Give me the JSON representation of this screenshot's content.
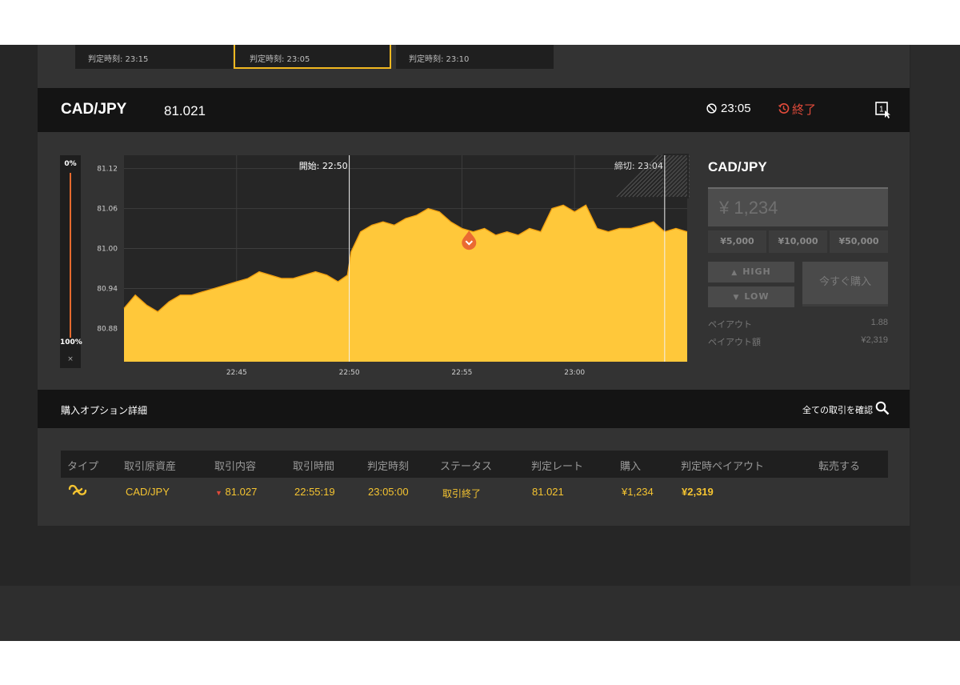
{
  "top_cards": [
    {
      "text": "判定時刻: 23:15"
    },
    {
      "text": "判定時刻: 23:05"
    },
    {
      "text": "判定時刻: 23:10"
    }
  ],
  "header": {
    "pair": "CAD/JPY",
    "price": "81.021",
    "timer": "23:05",
    "status": "終了"
  },
  "slider": {
    "top_label": "0%",
    "bottom_label": "100%",
    "close_label": "×"
  },
  "chart_data": {
    "type": "area",
    "y_ticks": [
      "81.12",
      "81.06",
      "81.00",
      "80.94",
      "80.88"
    ],
    "x_ticks": [
      "22:45",
      "22:50",
      "22:55",
      "23:00"
    ],
    "ylim": [
      80.83,
      81.14
    ],
    "start_label": "開始: 22:50",
    "deadline_label": "締切: 23:04",
    "entry_marker": {
      "time": "22:55:19",
      "value": 81.01
    },
    "series": [
      {
        "x": [
          "22:40:00",
          "22:40:30",
          "22:41:00",
          "22:41:30",
          "22:42:00",
          "22:42:30",
          "22:43:00",
          "22:43:30",
          "22:44:00",
          "22:44:30",
          "22:45:00",
          "22:45:30",
          "22:46:00",
          "22:46:30",
          "22:47:00",
          "22:47:30",
          "22:48:00",
          "22:48:30",
          "22:49:00",
          "22:49:30",
          "22:49:55",
          "22:50:05",
          "22:50:30",
          "22:51:00",
          "22:51:30",
          "22:52:00",
          "22:52:30",
          "22:53:00",
          "22:53:30",
          "22:54:00",
          "22:54:30",
          "22:55:00",
          "22:55:30",
          "22:56:00",
          "22:56:30",
          "22:57:00",
          "22:57:30",
          "22:58:00",
          "22:58:30",
          "22:59:00",
          "22:59:30",
          "23:00:00",
          "23:00:30",
          "23:01:00",
          "23:01:30",
          "23:02:00",
          "23:02:30",
          "23:03:00",
          "23:03:30",
          "23:04:00",
          "23:04:30",
          "23:05:00"
        ],
        "values": [
          80.91,
          80.93,
          80.915,
          80.905,
          80.92,
          80.93,
          80.93,
          80.935,
          80.94,
          80.945,
          80.95,
          80.955,
          80.965,
          80.96,
          80.955,
          80.955,
          80.96,
          80.965,
          80.96,
          80.95,
          80.96,
          80.995,
          81.025,
          81.035,
          81.04,
          81.035,
          81.045,
          81.05,
          81.06,
          81.055,
          81.04,
          81.03,
          81.025,
          81.03,
          81.02,
          81.025,
          81.02,
          81.03,
          81.025,
          81.06,
          81.065,
          81.055,
          81.065,
          81.03,
          81.025,
          81.03,
          81.03,
          81.035,
          81.04,
          81.025,
          81.03,
          81.025
        ]
      }
    ]
  },
  "trade": {
    "pair": "CAD/JPY",
    "amount": "¥ 1,234",
    "presets": [
      "¥5,000",
      "¥10,000",
      "¥50,000"
    ],
    "high_label": "HIGH",
    "low_label": "LOW",
    "buy_now": "今すぐ購入",
    "payout_label": "ペイアウト",
    "payout_value": "1.88",
    "payout_amount_label": "ペイアウト額",
    "payout_amount_value": "¥2,319"
  },
  "details": {
    "title": "購入オプション詳細",
    "view_all": "全ての取引を確認"
  },
  "table": {
    "headers": [
      "タイプ",
      "取引原資産",
      "取引内容",
      "取引時間",
      "判定時刻",
      "ステータス",
      "判定レート",
      "購入",
      "判定時ペイアウト",
      "転売する"
    ],
    "rows": [
      {
        "asset": "CAD/JPY",
        "content": "81.027",
        "time": "22:55:19",
        "judge_time": "23:05:00",
        "status": "取引終了",
        "rate": "81.021",
        "purchase": "¥1,234",
        "payout": "¥2,319"
      }
    ]
  },
  "colors": {
    "accent": "#f1b820",
    "area_fill": "#ffc83a",
    "down": "#e04a3a",
    "panel": "#333333"
  }
}
